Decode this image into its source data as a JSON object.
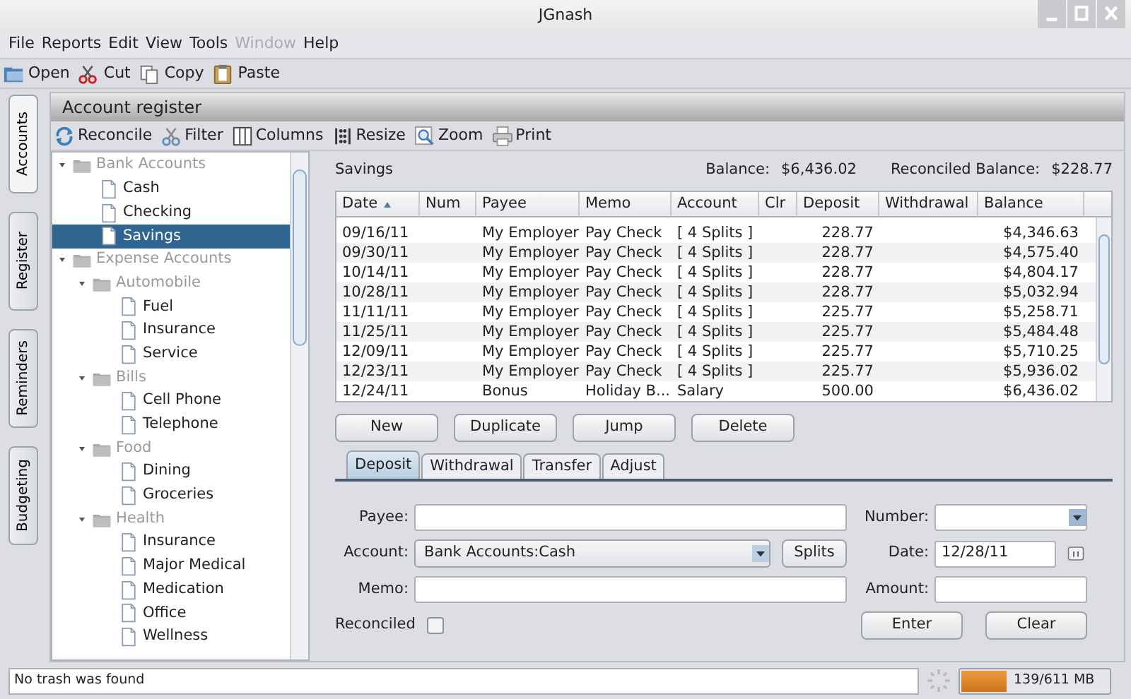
{
  "window": {
    "title": "JGnash"
  },
  "menu": [
    {
      "label": "File",
      "disabled": false
    },
    {
      "label": "Reports",
      "disabled": false
    },
    {
      "label": "Edit",
      "disabled": false
    },
    {
      "label": "View",
      "disabled": false
    },
    {
      "label": "Tools",
      "disabled": false
    },
    {
      "label": "Window",
      "disabled": true
    },
    {
      "label": "Help",
      "disabled": false
    }
  ],
  "toolbar": [
    {
      "label": "Open",
      "kind": "open"
    },
    {
      "label": "Cut",
      "kind": "cut"
    },
    {
      "label": "Copy",
      "kind": "copy"
    },
    {
      "label": "Paste",
      "kind": "paste"
    }
  ],
  "side_tabs": [
    {
      "label": "Accounts",
      "selected": true
    },
    {
      "label": "Register",
      "selected": false
    },
    {
      "label": "Reminders",
      "selected": false
    },
    {
      "label": "Budgeting",
      "selected": false
    }
  ],
  "panel": {
    "title": "Account register",
    "tools": [
      {
        "label": "Reconcile",
        "kind": "reconcile"
      },
      {
        "label": "Filter",
        "kind": "filter"
      },
      {
        "label": "Columns",
        "kind": "columns"
      },
      {
        "label": "Resize",
        "kind": "resize"
      },
      {
        "label": "Zoom",
        "kind": "zoom"
      },
      {
        "label": "Print",
        "kind": "print"
      }
    ]
  },
  "tree": [
    {
      "label": "Bank Accounts",
      "kind": "group",
      "expanded": true,
      "selected": false,
      "children": [
        {
          "label": "Cash",
          "kind": "account",
          "selected": false
        },
        {
          "label": "Checking",
          "kind": "account",
          "selected": false
        },
        {
          "label": "Savings",
          "kind": "account",
          "selected": true
        }
      ]
    },
    {
      "label": "Expense Accounts",
      "kind": "group",
      "expanded": true,
      "selected": false,
      "children": [
        {
          "label": "Automobile",
          "kind": "group",
          "expanded": true,
          "selected": false,
          "children": [
            {
              "label": "Fuel",
              "kind": "account",
              "selected": false
            },
            {
              "label": "Insurance",
              "kind": "account",
              "selected": false
            },
            {
              "label": "Service",
              "kind": "account",
              "selected": false
            }
          ]
        },
        {
          "label": "Bills",
          "kind": "group",
          "expanded": true,
          "selected": false,
          "children": [
            {
              "label": "Cell Phone",
              "kind": "account",
              "selected": false
            },
            {
              "label": "Telephone",
              "kind": "account",
              "selected": false
            }
          ]
        },
        {
          "label": "Food",
          "kind": "group",
          "expanded": true,
          "selected": false,
          "children": [
            {
              "label": "Dining",
              "kind": "account",
              "selected": false
            },
            {
              "label": "Groceries",
              "kind": "account",
              "selected": false
            }
          ]
        },
        {
          "label": "Health",
          "kind": "group",
          "expanded": true,
          "selected": false,
          "children": [
            {
              "label": "Insurance",
              "kind": "account",
              "selected": false
            },
            {
              "label": "Major Medical",
              "kind": "account",
              "selected": false
            },
            {
              "label": "Medication",
              "kind": "account",
              "selected": false
            },
            {
              "label": "Office",
              "kind": "account",
              "selected": false
            },
            {
              "label": "Wellness",
              "kind": "account",
              "selected": false
            }
          ]
        }
      ]
    }
  ],
  "register": {
    "account": "Savings",
    "balance_label": "Balance:",
    "balance": "$6,436.02",
    "reconciled_label": "Reconciled Balance:",
    "reconciled_balance": "$228.77",
    "columns": [
      {
        "label": "Date",
        "sorted": true
      },
      {
        "label": "Num",
        "sorted": false
      },
      {
        "label": "Payee",
        "sorted": false
      },
      {
        "label": "Memo",
        "sorted": false
      },
      {
        "label": "Account",
        "sorted": false
      },
      {
        "label": "Clr",
        "sorted": false
      },
      {
        "label": "Deposit",
        "sorted": false
      },
      {
        "label": "Withdrawal",
        "sorted": false
      },
      {
        "label": "Balance",
        "sorted": false
      }
    ],
    "rows": [
      [
        "09/16/11",
        "",
        "My Employer",
        "Pay Check",
        "[ 4 Splits ]",
        "",
        "228.77",
        "",
        "$4,346.63"
      ],
      [
        "09/30/11",
        "",
        "My Employer",
        "Pay Check",
        "[ 4 Splits ]",
        "",
        "228.77",
        "",
        "$4,575.40"
      ],
      [
        "10/14/11",
        "",
        "My Employer",
        "Pay Check",
        "[ 4 Splits ]",
        "",
        "228.77",
        "",
        "$4,804.17"
      ],
      [
        "10/28/11",
        "",
        "My Employer",
        "Pay Check",
        "[ 4 Splits ]",
        "",
        "228.77",
        "",
        "$5,032.94"
      ],
      [
        "11/11/11",
        "",
        "My Employer",
        "Pay Check",
        "[ 4 Splits ]",
        "",
        "225.77",
        "",
        "$5,258.71"
      ],
      [
        "11/25/11",
        "",
        "My Employer",
        "Pay Check",
        "[ 4 Splits ]",
        "",
        "225.77",
        "",
        "$5,484.48"
      ],
      [
        "12/09/11",
        "",
        "My Employer",
        "Pay Check",
        "[ 4 Splits ]",
        "",
        "225.77",
        "",
        "$5,710.25"
      ],
      [
        "12/23/11",
        "",
        "My Employer",
        "Pay Check",
        "[ 4 Splits ]",
        "",
        "225.77",
        "",
        "$5,936.02"
      ],
      [
        "12/24/11",
        "",
        "Bonus",
        "Holiday B...",
        "Salary",
        "",
        "500.00",
        "",
        "$6,436.02"
      ]
    ],
    "buttons": [
      "New",
      "Duplicate",
      "Jump",
      "Delete"
    ]
  },
  "form": {
    "tabs": [
      {
        "label": "Deposit",
        "selected": true
      },
      {
        "label": "Withdrawal",
        "selected": false
      },
      {
        "label": "Transfer",
        "selected": false
      },
      {
        "label": "Adjust",
        "selected": false
      }
    ],
    "payee_label": "Payee:",
    "account_label": "Account:",
    "account_value": "Bank Accounts:Cash",
    "splits_button": "Splits",
    "memo_label": "Memo:",
    "number_label": "Number:",
    "date_label": "Date:",
    "date_value": "12/28/11",
    "amount_label": "Amount:",
    "reconciled_label": "Reconciled",
    "reconciled_checked": false,
    "buttons": [
      "Enter",
      "Clear"
    ]
  },
  "status_bar": {
    "message": "No trash was found",
    "memory": "139/611 MB",
    "level": 0.3
  }
}
